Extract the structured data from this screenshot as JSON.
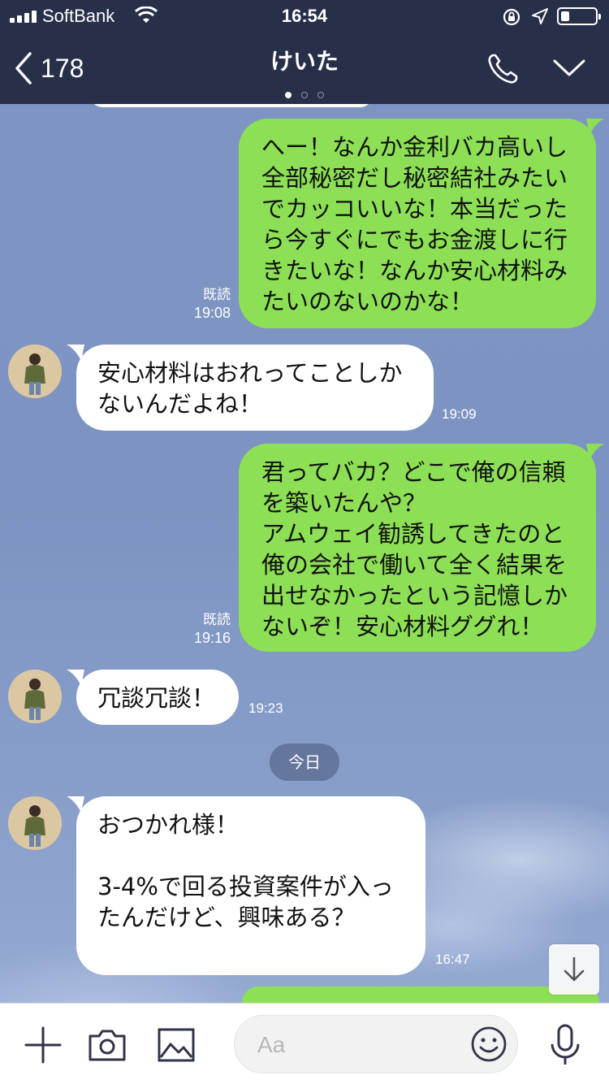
{
  "status_bar": {
    "carrier": "SoftBank",
    "time": "16:54"
  },
  "header": {
    "back_count": "178",
    "title": "けいた",
    "page_indicator": {
      "count": 3,
      "active_index": 0
    }
  },
  "messages": [
    {
      "sender": "me",
      "text": "へー！なんか金利バカ高いし\n全部秘密だし秘密結社みたい\nでカッコいいな！本当だった\nら今すぐにでもお金渡しに行\nきたいな！なんか安心材料み\nたいのないのかな！",
      "read_label": "既読",
      "time": "19:08"
    },
    {
      "sender": "them",
      "text": "安心材料はおれってことしか\nないんだよね！",
      "time": "19:09"
    },
    {
      "sender": "me",
      "text": "君ってバカ？どこで俺の信頼\nを築いたんや？\nアムウェイ勧誘してきたのと\n俺の会社で働いて全く結果を\n出せなかったという記憶しか\nないぞ！安心材料ググれ！",
      "read_label": "既読",
      "time": "19:16"
    },
    {
      "sender": "them",
      "text": "冗談冗談！",
      "time": "19:23"
    },
    {
      "sender": "them",
      "text": "おつかれ様！\n\n3-4%で回る投資案件が入っ\nたんだけど、興味ある？",
      "time": "16:47"
    }
  ],
  "date_separator": "今日",
  "input_bar": {
    "placeholder": "Aa"
  },
  "colors": {
    "header_bg": "#283049",
    "my_bubble": "#8de055",
    "their_bubble": "#ffffff",
    "chat_bg": "#7e95c3"
  },
  "icons": [
    "back-chevron-icon",
    "phone-icon",
    "chevron-down-icon",
    "plus-icon",
    "camera-icon",
    "image-icon",
    "emoji-icon",
    "microphone-icon",
    "arrow-down-icon",
    "wifi-icon",
    "rotation-lock-icon",
    "location-arrow-icon",
    "battery-icon",
    "signal-icon"
  ]
}
